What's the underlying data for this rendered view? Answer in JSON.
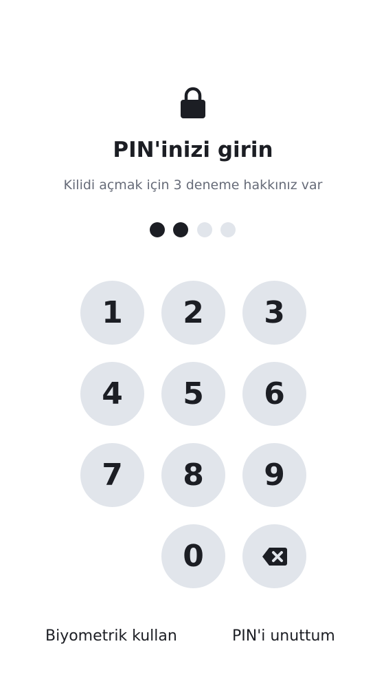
{
  "header": {
    "icon": "lock-icon",
    "title": "PIN'inizi girin",
    "subtitle": "Kilidi açmak için 3 deneme hakkınız var"
  },
  "pin": {
    "length": 4,
    "entered": 2
  },
  "keypad": {
    "keys": [
      "1",
      "2",
      "3",
      "4",
      "5",
      "6",
      "7",
      "8",
      "9",
      "0"
    ],
    "backspace_icon": "backspace-icon"
  },
  "footer": {
    "biometric_label": "Biyometrik kullan",
    "forgot_label": "PIN'i unuttum"
  },
  "colors": {
    "text": "#1c1e24",
    "muted": "#666b78",
    "key_bg": "#e1e5eb",
    "background": "#ffffff"
  }
}
